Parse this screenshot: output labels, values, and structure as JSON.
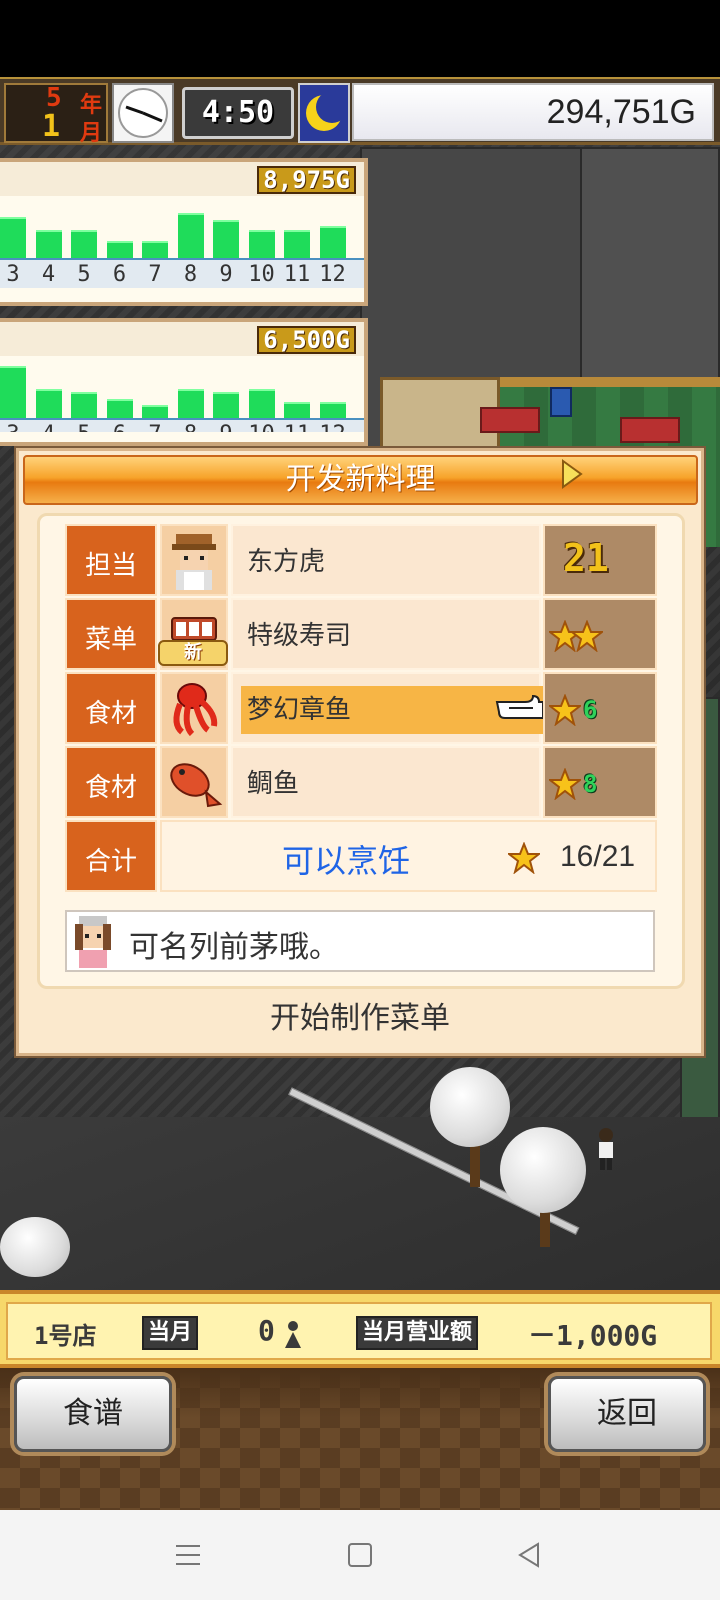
{
  "hud": {
    "year_num": "5",
    "year_unit": "年",
    "month_num": "1",
    "month_unit": "月",
    "time": "4:50",
    "money": "294,751G"
  },
  "graphs": [
    {
      "value": "8,975G",
      "bars": [
        0.7,
        0.48,
        0.48,
        0.3,
        0.3,
        0.78,
        0.65,
        0.48,
        0.48,
        0.55
      ],
      "labels": [
        "3",
        "4",
        "5",
        "6",
        "7",
        "8",
        "9",
        "10",
        "11",
        "12"
      ]
    },
    {
      "value": "6,500G",
      "bars": [
        0.9,
        0.5,
        0.45,
        0.32,
        0.22,
        0.5,
        0.45,
        0.5,
        0.28,
        0.28
      ],
      "labels": [
        "3",
        "4",
        "5",
        "6",
        "7",
        "8",
        "9",
        "10",
        "11",
        "12"
      ]
    }
  ],
  "dialog": {
    "title": "开发新料理",
    "rows": [
      {
        "label": "担当",
        "value": "东方虎",
        "stat": "21"
      },
      {
        "label": "菜单",
        "value": "特级寿司",
        "new_tag": "新"
      },
      {
        "label": "食材",
        "value": "梦幻章鱼",
        "stat": "6"
      },
      {
        "label": "食材",
        "value": "鲷鱼",
        "stat": "8"
      }
    ],
    "total_label": "合计",
    "cook_status": "可以烹饪",
    "total": "16/21",
    "comment": "可名列前茅哦。",
    "start_button": "开始制作菜单"
  },
  "status_bar": {
    "shop": "1号店",
    "month_label": "当月",
    "customers": "0",
    "sales_label": "当月营业额",
    "sales": "－1,000G"
  },
  "buttons": {
    "recipe": "食谱",
    "back": "返回"
  },
  "colors": {
    "accent_orange": "#d8631d",
    "cook_blue": "#1f64e6",
    "bar_green": "#1fdc5a"
  }
}
